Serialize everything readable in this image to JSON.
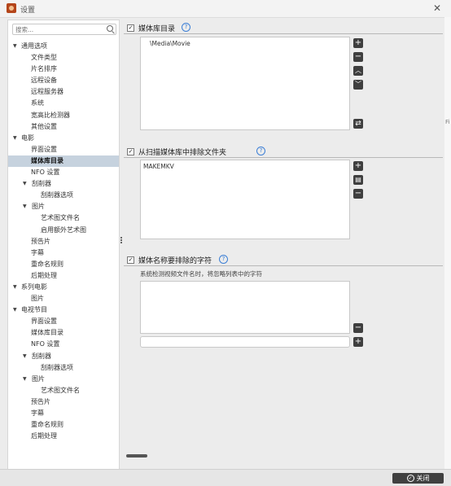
{
  "window": {
    "title": "设置",
    "close_symbol": "✕"
  },
  "sidebar": {
    "search_placeholder": "搜索...",
    "tree": [
      {
        "label": "通用选项",
        "level": 0,
        "expanded": true
      },
      {
        "label": "文件类型",
        "level": 1
      },
      {
        "label": "片名排序",
        "level": 1
      },
      {
        "label": "远程设备",
        "level": 1
      },
      {
        "label": "远程服务器",
        "level": 1
      },
      {
        "label": "系统",
        "level": 1
      },
      {
        "label": "宽高比检测器",
        "level": 1
      },
      {
        "label": "其他设置",
        "level": 1
      },
      {
        "label": "电影",
        "level": 0,
        "expanded": true
      },
      {
        "label": "界面设置",
        "level": 1
      },
      {
        "label": "媒体库目录",
        "level": 1,
        "selected": true
      },
      {
        "label": "NFO 设置",
        "level": 1
      },
      {
        "label": "刮削器",
        "level": 1,
        "expanded": true
      },
      {
        "label": "刮削器选项",
        "level": 2
      },
      {
        "label": "图片",
        "level": 1,
        "expanded": true
      },
      {
        "label": "艺术图文件名",
        "level": 2
      },
      {
        "label": "启用额外艺术图",
        "level": 2
      },
      {
        "label": "预告片",
        "level": 1
      },
      {
        "label": "字幕",
        "level": 1
      },
      {
        "label": "重命名规则",
        "level": 1
      },
      {
        "label": "后期处理",
        "level": 1
      },
      {
        "label": "系列电影",
        "level": 0,
        "expanded": true
      },
      {
        "label": "图片",
        "level": 1
      },
      {
        "label": "电视节目",
        "level": 0,
        "expanded": true
      },
      {
        "label": "界面设置",
        "level": 1
      },
      {
        "label": "媒体库目录",
        "level": 1
      },
      {
        "label": "NFO 设置",
        "level": 1
      },
      {
        "label": "刮削器",
        "level": 1,
        "expanded": true
      },
      {
        "label": "刮削器选项",
        "level": 2
      },
      {
        "label": "图片",
        "level": 1,
        "expanded": true
      },
      {
        "label": "艺术图文件名",
        "level": 2
      },
      {
        "label": "预告片",
        "level": 1
      },
      {
        "label": "字幕",
        "level": 1
      },
      {
        "label": "重命名规则",
        "level": 1
      },
      {
        "label": "后期处理",
        "level": 1
      }
    ]
  },
  "sections": {
    "media_dirs": {
      "title": "媒体库目录",
      "checked": true,
      "items": [
        "\\Media\\Movie"
      ],
      "buttons": [
        "+",
        "−",
        "︿",
        "﹀",
        "⇄"
      ]
    },
    "exclude_dirs": {
      "title": "从扫描媒体库中排除文件夹",
      "checked": true,
      "items": [
        "MAKEMKV"
      ],
      "buttons": [
        "+",
        "▤",
        "−"
      ]
    },
    "exclude_chars": {
      "title": "媒体名称要排除的字符",
      "checked": true,
      "hint": "系统检测视频文件名时，将忽略列表中的字符",
      "items": [],
      "remove_button": "−",
      "add_button": "+",
      "input_value": ""
    }
  },
  "footer": {
    "close_label": "关闭",
    "close_icon": "✓"
  },
  "colors": {
    "accent": "#3c7fd6",
    "selection": "#c6d2de",
    "button_dark": "#3f3f3f"
  }
}
